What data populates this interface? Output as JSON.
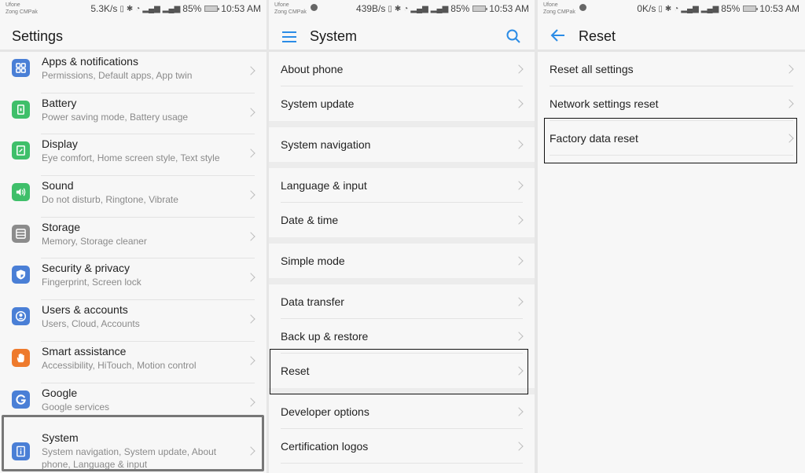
{
  "panels": [
    {
      "status": {
        "carrier1": "Ufone",
        "carrier2": "Zong CMPak",
        "net_speed": "5.3K/s",
        "battery": "85%",
        "time": "10:53 AM"
      },
      "title": "Settings",
      "items": [
        {
          "title": "Apps & notifications",
          "subtitle": "Permissions, Default apps, App twin",
          "icon": "apps-icon",
          "color": "#4a7fd6"
        },
        {
          "title": "Battery",
          "subtitle": "Power saving mode, Battery usage",
          "icon": "battery-icon",
          "color": "#3fbf6a"
        },
        {
          "title": "Display",
          "subtitle": "Eye comfort, Home screen style, Text style",
          "icon": "display-icon",
          "color": "#3fbf6a"
        },
        {
          "title": "Sound",
          "subtitle": "Do not disturb, Ringtone, Vibrate",
          "icon": "sound-icon",
          "color": "#3fbf6a"
        },
        {
          "title": "Storage",
          "subtitle": "Memory, Storage cleaner",
          "icon": "storage-icon",
          "color": "#8c8c8c"
        },
        {
          "title": "Security & privacy",
          "subtitle": "Fingerprint, Screen lock",
          "icon": "shield-icon",
          "color": "#4a7fd6"
        },
        {
          "title": "Users & accounts",
          "subtitle": "Users, Cloud, Accounts",
          "icon": "user-icon",
          "color": "#4a7fd6"
        },
        {
          "title": "Smart assistance",
          "subtitle": "Accessibility, HiTouch, Motion control",
          "icon": "hand-icon",
          "color": "#ee7a2c"
        },
        {
          "title": "Google",
          "subtitle": "Google services",
          "icon": "google-icon",
          "color": "#4a7fd6"
        },
        {
          "title": "System",
          "subtitle": "System navigation, System update, About phone, Language & input",
          "icon": "system-info-icon",
          "color": "#4a7fd6",
          "highlighted": true
        }
      ]
    },
    {
      "status": {
        "carrier1": "Ufone",
        "carrier2": "Zong CMPak",
        "net_speed": "439B/s",
        "battery": "85%",
        "time": "10:53 AM"
      },
      "title": "System",
      "items": [
        {
          "label": "About phone"
        },
        {
          "label": "System update"
        },
        {
          "label": "System navigation"
        },
        {
          "label": "Language & input"
        },
        {
          "label": "Date & time"
        },
        {
          "label": "Simple mode"
        },
        {
          "label": "Data transfer"
        },
        {
          "label": "Back up & restore"
        },
        {
          "label": "Reset",
          "highlighted": true
        },
        {
          "label": "Developer options"
        },
        {
          "label": "Certification logos"
        }
      ]
    },
    {
      "status": {
        "carrier1": "Ufone",
        "carrier2": "Zong CMPak",
        "net_speed": "0K/s",
        "battery": "85%",
        "time": "10:53 AM"
      },
      "title": "Reset",
      "items": [
        {
          "label": "Reset all settings"
        },
        {
          "label": "Network settings reset"
        },
        {
          "label": "Factory data reset",
          "highlighted": true
        }
      ]
    }
  ],
  "colors": {
    "accent": "#2b8ce6",
    "background": "#f7f7f7",
    "divider": "#e3e3e3"
  }
}
